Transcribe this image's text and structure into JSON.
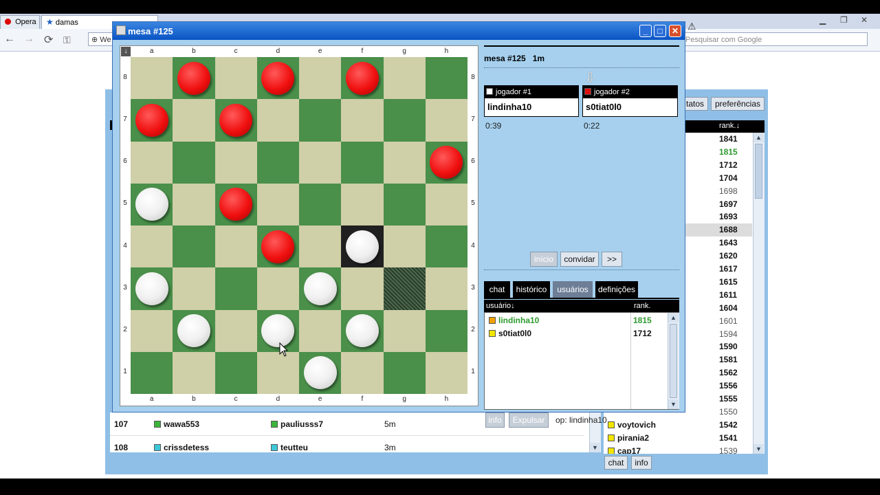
{
  "browser": {
    "tabs": [
      {
        "label": "Opera"
      },
      {
        "label": "damas"
      }
    ],
    "address_partial": "We",
    "search_placeholder": "Pesquisar com Google",
    "window_controls": [
      "▁",
      "❐",
      "✕"
    ]
  },
  "lobby": {
    "top_buttons": [
      {
        "label": "tatos"
      },
      {
        "label": "preferências"
      }
    ],
    "rank_header": "rank.↓",
    "rank_values": [
      "1841",
      "1815",
      "1712",
      "1704",
      "1698",
      "1697",
      "1693",
      "1688",
      "1643",
      "1620",
      "1617",
      "1615",
      "1611",
      "1604",
      "1601",
      "1594",
      "1590",
      "1581",
      "1562",
      "1556",
      "1555",
      "1550",
      "1542",
      "1541",
      "1539"
    ],
    "rank_names": [
      {
        "row": 22,
        "name": "voytovich",
        "color": "#f2e600"
      },
      {
        "row": 23,
        "name": "pirania2",
        "color": "#f2e600"
      },
      {
        "row": 24,
        "name": "cap17",
        "color": "#f2e600"
      }
    ],
    "bottom_buttons": [
      {
        "label": "chat"
      },
      {
        "label": "info"
      }
    ],
    "tables": [
      {
        "id": "107",
        "p1": "wawa553",
        "p1_color": "#3cb43c",
        "p2": "pauliusss7",
        "p2_color": "#3cb43c",
        "time": "5m"
      },
      {
        "id": "108",
        "p1": "crissdetess",
        "p1_color": "#3cc8d8",
        "p2": "teutteu",
        "p2_color": "#3cc8d8",
        "time": "3m"
      }
    ]
  },
  "window": {
    "title": "mesa #125",
    "controls": [
      "_",
      "□",
      "✕"
    ]
  },
  "board": {
    "files": [
      "a",
      "b",
      "c",
      "d",
      "e",
      "f",
      "g",
      "h"
    ],
    "ranks": [
      "8",
      "7",
      "6",
      "5",
      "4",
      "3",
      "2",
      "1"
    ],
    "flip_icon": "↓",
    "pieces": [
      {
        "square": "b8",
        "color": "red"
      },
      {
        "square": "d8",
        "color": "red"
      },
      {
        "square": "f8",
        "color": "red"
      },
      {
        "square": "a7",
        "color": "red"
      },
      {
        "square": "c7",
        "color": "red"
      },
      {
        "square": "h6",
        "color": "red"
      },
      {
        "square": "a5",
        "color": "white"
      },
      {
        "square": "c5",
        "color": "red"
      },
      {
        "square": "d4",
        "color": "red"
      },
      {
        "square": "f4",
        "color": "white"
      },
      {
        "square": "a3",
        "color": "white"
      },
      {
        "square": "e3",
        "color": "white"
      },
      {
        "square": "b2",
        "color": "white"
      },
      {
        "square": "d2",
        "color": "white"
      },
      {
        "square": "f2",
        "color": "white"
      },
      {
        "square": "e1",
        "color": "white"
      }
    ],
    "highlight_last": "f4",
    "highlight_from": "g3"
  },
  "game": {
    "header": "mesa #125   1m",
    "turn_arrow": "⇩",
    "players": [
      {
        "label": "jogador #1",
        "name": "lindinha10",
        "time": "0:39",
        "color": "#ffffff"
      },
      {
        "label": "jogador #2",
        "name": "s0tiat0l0",
        "time": "0:22",
        "color": "#e01010"
      }
    ],
    "buttons": [
      {
        "label": "início",
        "disabled": true
      },
      {
        "label": "convidar",
        "disabled": false
      },
      {
        "label": ">>",
        "disabled": false
      }
    ],
    "tabs": [
      {
        "label": "chat"
      },
      {
        "label": "histórico"
      },
      {
        "label": "usuários"
      },
      {
        "label": "definições"
      }
    ],
    "active_tab": 2,
    "users_header": {
      "user": "usuário↓",
      "rank": "rank."
    },
    "users": [
      {
        "name": "lindinha10",
        "rank": "1815",
        "color": "#f0a000",
        "highlight": true
      },
      {
        "name": "s0tiat0l0",
        "rank": "1712",
        "color": "#f2e600",
        "highlight": false
      }
    ],
    "footer_buttons": [
      {
        "label": "info"
      },
      {
        "label": "Expulsar"
      }
    ],
    "op_text": "op: lindinha10"
  }
}
